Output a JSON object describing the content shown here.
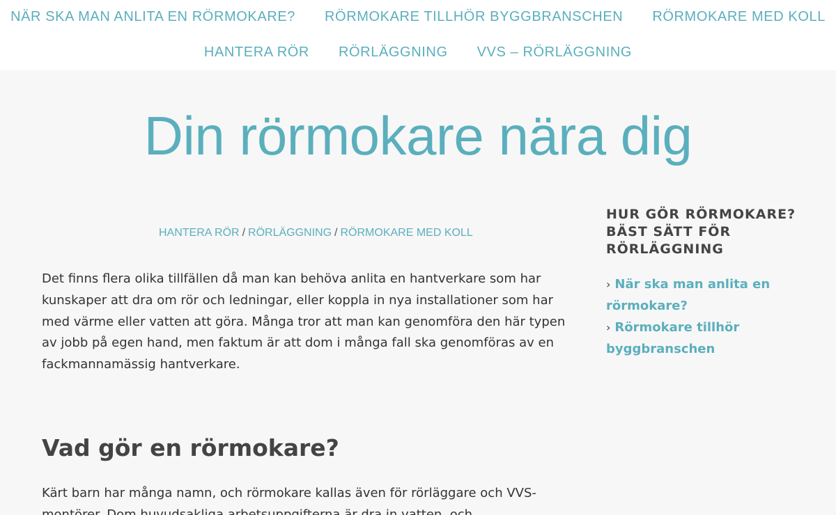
{
  "nav": {
    "row1": [
      {
        "label": "NÄR SKA MAN ANLITA EN RÖRMOKARE?"
      },
      {
        "label": "RÖRMOKARE TILLHÖR BYGGBRANSCHEN"
      },
      {
        "label": "RÖRMOKARE MED KOLL"
      }
    ],
    "row2": [
      {
        "label": "HANTERA RÖR"
      },
      {
        "label": "RÖRLÄGGNING"
      },
      {
        "label": "VVS – RÖRLÄGGNING"
      }
    ]
  },
  "site": {
    "title": "Din rörmokare nära dig"
  },
  "breadcrumb": {
    "items": [
      "HANTERA RÖR",
      "RÖRLÄGGNING",
      "RÖRMOKARE MED KOLL"
    ],
    "separator": "/"
  },
  "content": {
    "intro": "Det finns flera olika tillfällen då man kan behöva anlita en hantverkare som har kunskaper att dra om rör och ledningar, eller koppla in nya installationer som har med värme eller vatten att göra. Många tror att man kan genomföra den här typen av jobb på egen hand, men faktum är att dom i många fall ska genomföras av en fackmannamässig hantverkare.",
    "heading": "Vad gör en rörmokare?",
    "para2": "Kärt barn har många namn, och rörmokare kallas även för rörläggare och VVS-montörer. Dom huvudsakliga arbetsuppgifterna är dra in vatten, och"
  },
  "sidebar": {
    "widget_title": "HUR GÖR RÖRMOKARE? BÄST SÄTT FÖR RÖRLÄGGNING",
    "chevron": "›",
    "links": [
      {
        "label": "När ska man anlita en rörmokare?"
      },
      {
        "label": "Rörmokare tillhör byggbranschen"
      }
    ]
  },
  "colors": {
    "accent": "#5bafbd",
    "background": "#f7f7f7",
    "header_bg": "#ffffff",
    "text": "#333333"
  }
}
